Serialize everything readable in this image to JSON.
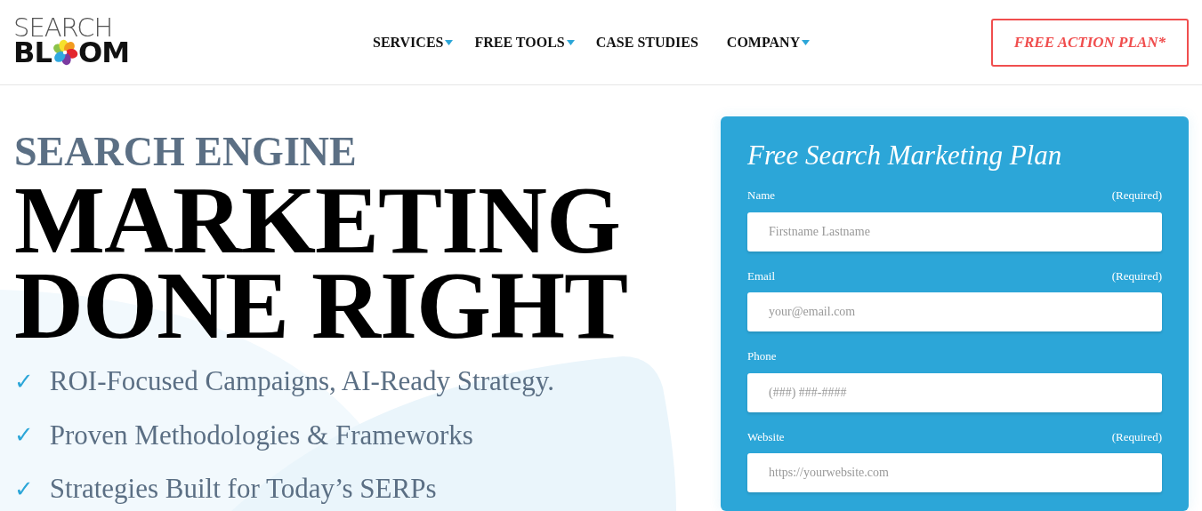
{
  "logo": {
    "top": "SEARCH",
    "bottom_left": "BL",
    "bottom_right": "OM"
  },
  "nav": [
    {
      "label": "SERVICES",
      "dropdown": true
    },
    {
      "label": "FREE TOOLS",
      "dropdown": true
    },
    {
      "label": "CASE STUDIES",
      "dropdown": false
    },
    {
      "label": "COMPANY",
      "dropdown": true
    }
  ],
  "cta_button": "FREE ACTION PLAN*",
  "hero": {
    "eyebrow": "SEARCH ENGINE",
    "headline_lines": [
      "MARKETING",
      "DONE RIGHT"
    ],
    "benefits": [
      {
        "mark": "✓",
        "text": "ROI-Focused Campaigns, AI-Ready Strategy."
      },
      {
        "mark": "✓",
        "text": "Proven Methodologies & Frameworks"
      },
      {
        "mark": "✓",
        "text": "Strategies Built for Today’s SERPs"
      }
    ]
  },
  "form": {
    "title": "Free Search Marketing Plan",
    "fields": [
      {
        "label": "Name",
        "required_note": "(Required)",
        "placeholder": "Firstname Lastname"
      },
      {
        "label": "Email",
        "required_note": "(Required)",
        "placeholder": "your@email.com"
      },
      {
        "label": "Phone",
        "placeholder": "(###) ###-####"
      },
      {
        "label": "Website",
        "required_note": "(Required)",
        "placeholder": "https://yourwebsite.com"
      }
    ]
  }
}
